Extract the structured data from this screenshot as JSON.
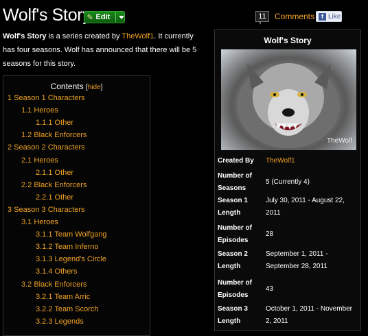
{
  "header": {
    "title": "Wolf's Story",
    "edit_label": "Edit",
    "comment_count": "11",
    "comments_label": "Comments",
    "like_label": "Like"
  },
  "intro": {
    "bold": "Wolf's Story",
    "text1": " is a series created by ",
    "link": "TheWolf1",
    "text2": ". It currently has four seasons. Wolf has announced that there will be 5 seasons for this story."
  },
  "toc": {
    "title": "Contents",
    "hide": "hide",
    "items": [
      {
        "label": "1 Season 1 Characters",
        "level": 1
      },
      {
        "label": "1.1 Heroes",
        "level": 2
      },
      {
        "label": "1.1.1 Other",
        "level": 3
      },
      {
        "label": "1.2 Black Enforcers",
        "level": 2
      },
      {
        "label": "2 Season 2 Characters",
        "level": 1
      },
      {
        "label": "2.1 Heroes",
        "level": 2
      },
      {
        "label": "2.1.1 Other",
        "level": 3
      },
      {
        "label": "2.2 Black Enforcers",
        "level": 2
      },
      {
        "label": "2.2.1 Other",
        "level": 3
      },
      {
        "label": "3 Season 3 Characters",
        "level": 1
      },
      {
        "label": "3.1 Heroes",
        "level": 2
      },
      {
        "label": "3.1.1 Team Wolfgang",
        "level": 3
      },
      {
        "label": "3.1.2 Team Inferno",
        "level": 3
      },
      {
        "label": "3.1.3 Legend's Circle",
        "level": 3
      },
      {
        "label": "3.1.4 Others",
        "level": 3
      },
      {
        "label": "3.2 Black Enforcers",
        "level": 2
      },
      {
        "label": "3.2.1 Team Arric",
        "level": 3
      },
      {
        "label": "3.2.2 Team Scorch",
        "level": 3
      },
      {
        "label": "3.2.3 Legends",
        "level": 3
      }
    ]
  },
  "infobox": {
    "title": "Wolf's Story",
    "image_caption": "TheWolf",
    "rows": [
      {
        "label": "Created By",
        "value": "TheWolf1",
        "link": true
      },
      {
        "label": "Number of Seasons",
        "value": "5 (Currently 4)"
      },
      {
        "label": "Season 1 Length",
        "value": "July 30, 2011 - August 22, 2011"
      },
      {
        "label": "Number of Episodes",
        "value": "28"
      },
      {
        "label": "Season 2 Length",
        "value": "September 1, 2011 - September 28, 2011"
      },
      {
        "label": "Number of Episodes",
        "value": "43"
      },
      {
        "label": "Season 3 Length",
        "value": "October 1, 2011 - November 2, 2011"
      }
    ]
  }
}
